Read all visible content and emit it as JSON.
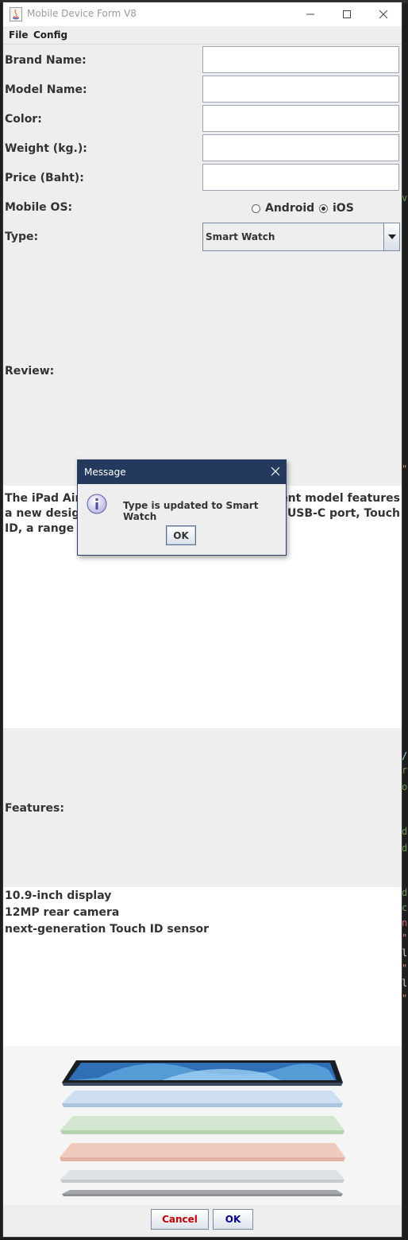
{
  "window": {
    "title": "Mobile Device Form V8"
  },
  "menu": {
    "items": [
      "File",
      "Config"
    ]
  },
  "form": {
    "brand_label": "Brand Name:",
    "model_label": "Model Name:",
    "color_label": "Color:",
    "weight_label": "Weight (kg.):",
    "price_label": "Price (Baht):",
    "os_label": "Mobile OS:",
    "os_options": [
      "Android",
      "iOS"
    ],
    "os_selected": "iOS",
    "type_label": "Type:",
    "type_value": "Smart Watch",
    "review_label": "Review:",
    "review_visible_lines": [
      [
        "The iPad Air i",
        "rrent model features"
      ],
      [
        "a new design",
        "USB-C port, Touch"
      ],
      [
        "ID, a range of",
        ""
      ]
    ],
    "features_label": "Features:",
    "features_lines": [
      "10.9-inch display",
      "12MP rear camera",
      "next-generation Touch ID sensor"
    ]
  },
  "buttons": {
    "cancel": "Cancel",
    "ok": "OK"
  },
  "dialog": {
    "title": "Message",
    "message": "Type is updated to Smart Watch",
    "ok": "OK"
  },
  "colors": {
    "dialog_title_bg": "#23395d",
    "cancel_text": "#cc0000",
    "ok_text": "#0000aa",
    "ipad_colors": [
      "#3a4a5e",
      "#a9c4dc",
      "#b7d4b1",
      "#e2b3a4",
      "#c7cbd0",
      "#8c8f94"
    ]
  }
}
